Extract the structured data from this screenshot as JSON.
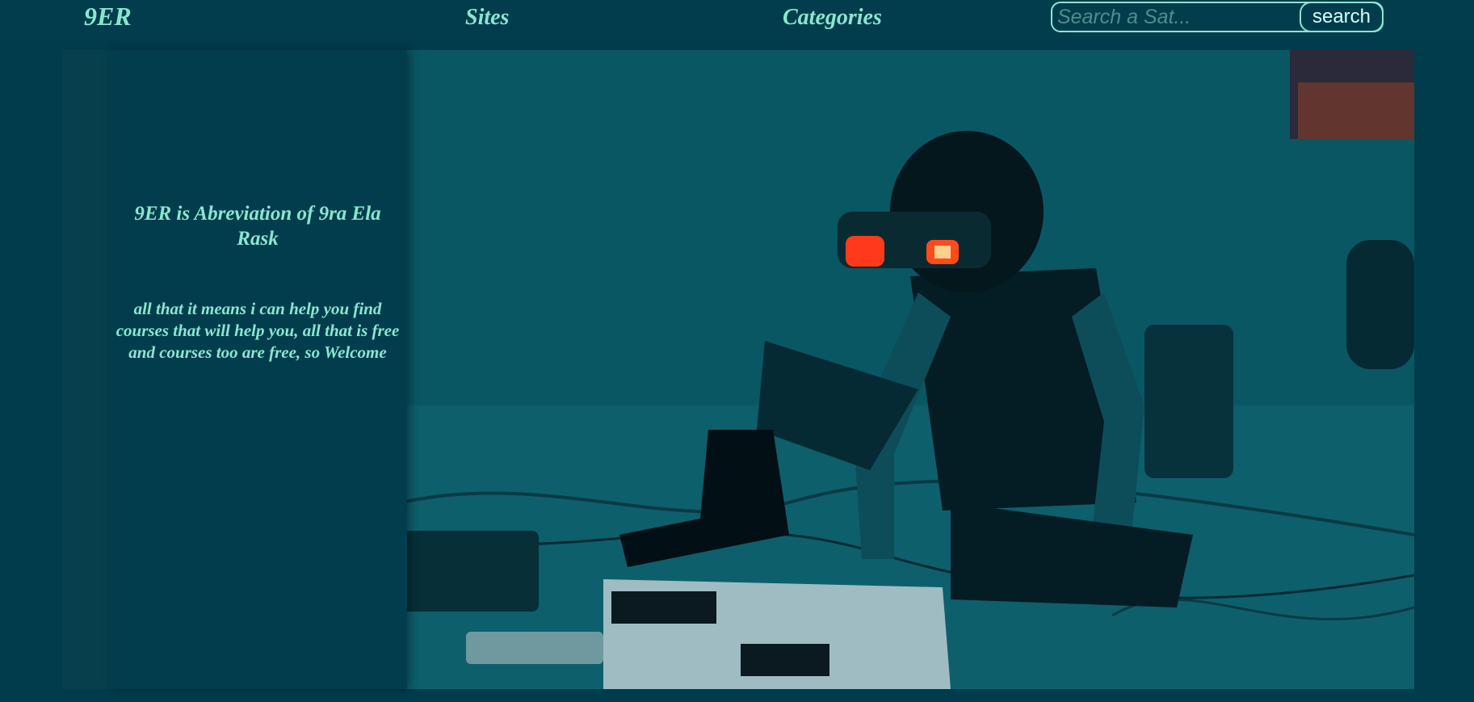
{
  "header": {
    "logo": "9ER",
    "nav": {
      "sites": "Sites",
      "categories": "Categories"
    },
    "search": {
      "placeholder": "Search a Sat...",
      "value": "",
      "button_label": "search"
    }
  },
  "hero": {
    "image_subject": "person-with-vr-headset"
  },
  "info_panel": {
    "title": "9ER is Abreviation of 9ra Ela Rask",
    "text": "all that it means i can help you find courses that will help you, all that is free and courses too are free, so Welcome"
  },
  "colors": {
    "background": "#013c4c",
    "accent_text": "#8ae6cf",
    "panel": "#023d4d"
  }
}
